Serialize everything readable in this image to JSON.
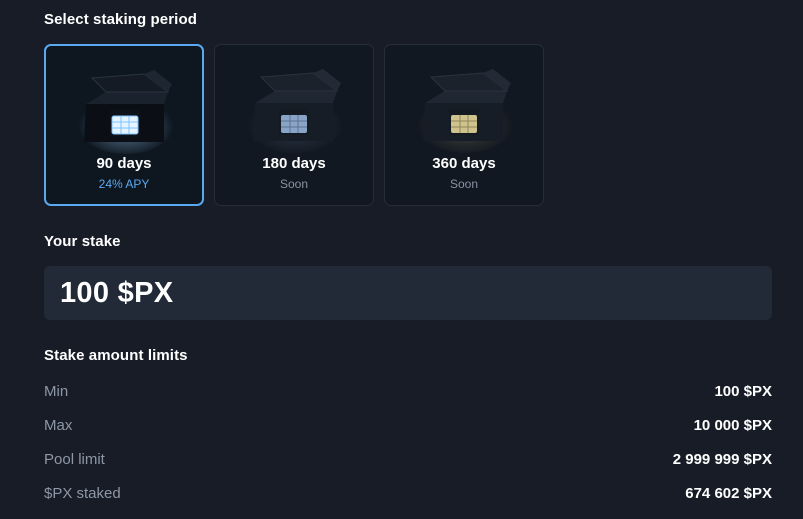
{
  "staking_period": {
    "title": "Select staking period",
    "options": [
      {
        "days": "90 days",
        "sub": "24% APY",
        "selected": true,
        "glow": "#cfe9ff"
      },
      {
        "days": "180 days",
        "sub": "Soon",
        "selected": false,
        "glow": "#9fb8d9"
      },
      {
        "days": "360 days",
        "sub": "Soon",
        "selected": false,
        "glow": "#d8cf9a"
      }
    ]
  },
  "stake": {
    "title": "Your stake",
    "value": "100 $PX"
  },
  "limits": {
    "title": "Stake amount limits",
    "rows": [
      {
        "label": "Min",
        "value": "100 $PX"
      },
      {
        "label": "Max",
        "value": "10 000 $PX"
      },
      {
        "label": "Pool limit",
        "value": "2 999 999 $PX"
      },
      {
        "label": "$PX staked",
        "value": "674 602 $PX"
      }
    ]
  },
  "colors": {
    "background": "#171c26",
    "accent": "#5aa8f0",
    "input_bg": "#222a38",
    "muted_text": "#8e97a7"
  }
}
